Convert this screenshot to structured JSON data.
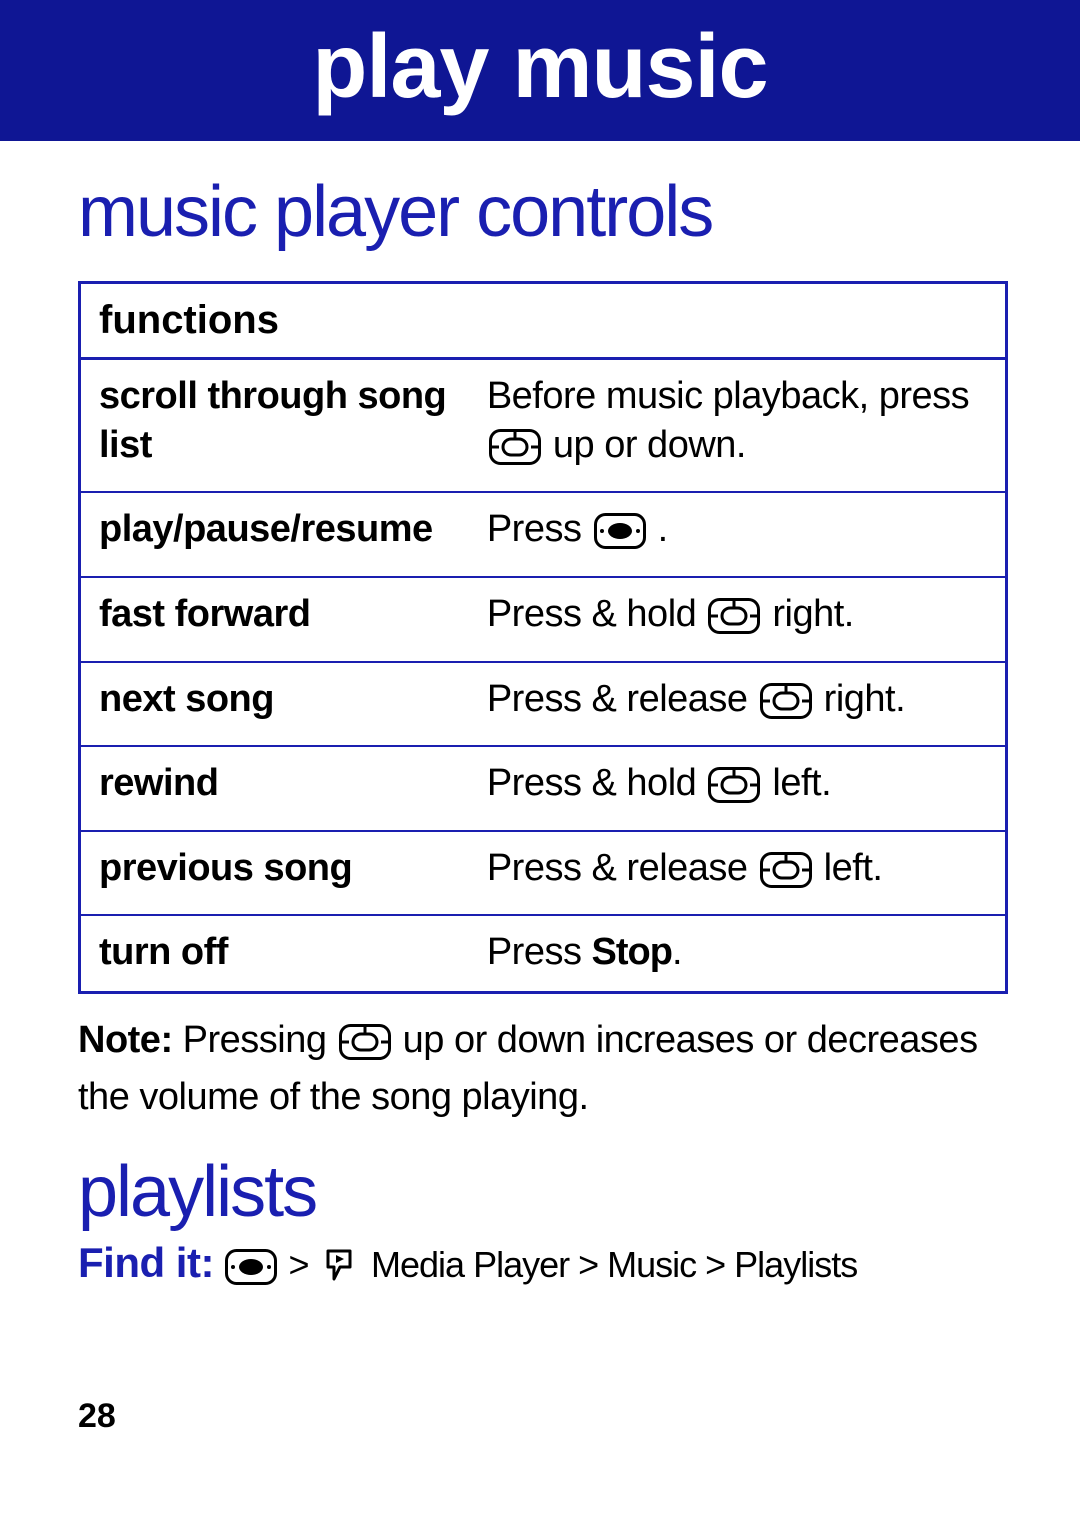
{
  "header": {
    "title": "play music"
  },
  "section1": {
    "heading": "music player controls",
    "table_header": "functions",
    "rows": [
      {
        "fn": "scroll through song list",
        "desc_pre": "Before music playback, press ",
        "icon": "nav",
        "desc_post": " up or down."
      },
      {
        "fn": "play/pause/resume",
        "desc_pre": "Press ",
        "icon": "center",
        "desc_post": " ."
      },
      {
        "fn": "fast forward",
        "desc_pre": "Press & hold ",
        "icon": "nav",
        "desc_post": " right."
      },
      {
        "fn": "next song",
        "desc_pre": "Press & release ",
        "icon": "nav",
        "desc_post": " right."
      },
      {
        "fn": "rewind",
        "desc_pre": "Press & hold ",
        "icon": "nav",
        "desc_post": " left."
      },
      {
        "fn": "previous song",
        "desc_pre": "Press & release ",
        "icon": "nav",
        "desc_post": " left."
      },
      {
        "fn": "turn off",
        "desc_pre": "Press ",
        "stop_word": "Stop",
        "desc_post": "."
      }
    ],
    "note": {
      "label": "Note:",
      "pre": " Pressing ",
      "post": " up or down increases or decreases the volume of the song playing."
    }
  },
  "section2": {
    "heading": "playlists",
    "findit_label": "Find it:",
    "sep": " > ",
    "path": "Media Player > Music > Playlists"
  },
  "page_number": "28"
}
